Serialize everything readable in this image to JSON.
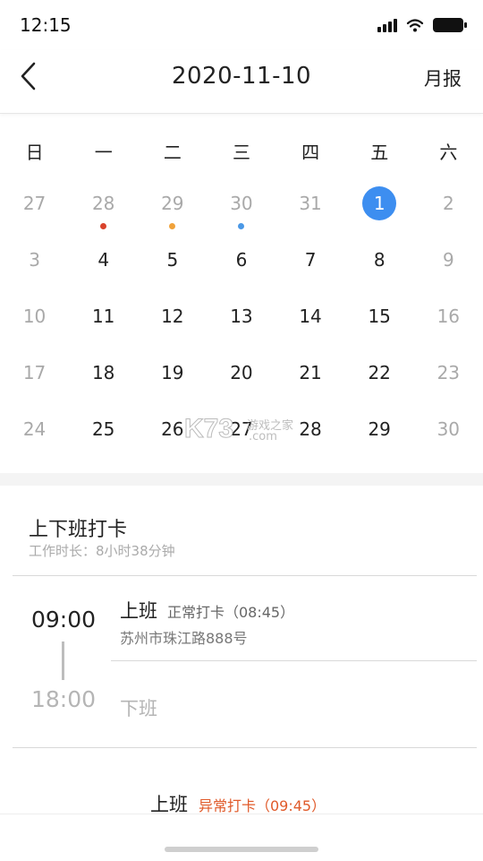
{
  "status_bar": {
    "time": "12:15"
  },
  "nav": {
    "title": "2020-11-10",
    "action": "月报"
  },
  "calendar": {
    "weekdays": [
      "日",
      "一",
      "二",
      "三",
      "四",
      "五",
      "六"
    ],
    "weeks": [
      [
        {
          "day": "27",
          "muted": true
        },
        {
          "day": "28",
          "muted": true,
          "dot": "#d9432c"
        },
        {
          "day": "29",
          "muted": true,
          "dot": "#f0a23a"
        },
        {
          "day": "30",
          "muted": true,
          "dot": "#4b98e6"
        },
        {
          "day": "31",
          "muted": true
        },
        {
          "day": "1",
          "selected": true
        },
        {
          "day": "2",
          "muted": true
        }
      ],
      [
        {
          "day": "3",
          "muted": true
        },
        {
          "day": "4"
        },
        {
          "day": "5"
        },
        {
          "day": "6"
        },
        {
          "day": "7"
        },
        {
          "day": "8"
        },
        {
          "day": "9",
          "muted": true
        }
      ],
      [
        {
          "day": "10",
          "muted": true
        },
        {
          "day": "11"
        },
        {
          "day": "12"
        },
        {
          "day": "13"
        },
        {
          "day": "14"
        },
        {
          "day": "15"
        },
        {
          "day": "16",
          "muted": true
        }
      ],
      [
        {
          "day": "17",
          "muted": true
        },
        {
          "day": "18"
        },
        {
          "day": "19"
        },
        {
          "day": "20"
        },
        {
          "day": "21"
        },
        {
          "day": "22"
        },
        {
          "day": "23",
          "muted": true
        }
      ],
      [
        {
          "day": "24",
          "muted": true
        },
        {
          "day": "25"
        },
        {
          "day": "26"
        },
        {
          "day": "27"
        },
        {
          "day": "28"
        },
        {
          "day": "29"
        },
        {
          "day": "30",
          "muted": true
        }
      ]
    ]
  },
  "watermark": {
    "brand": "K73",
    "cn": "游戏之家",
    "domain": ".com"
  },
  "attendance": {
    "title": "上下班打卡",
    "duration": "工作时长：8小时38分钟",
    "start_time": "09:00",
    "end_time": "18:00",
    "on_label": "上班",
    "on_status": "正常打卡（08:45）",
    "on_address": "苏州市珠江路888号",
    "off_label": "下班",
    "record_label": "上班",
    "record_status": "异常打卡（09:45）"
  },
  "colors": {
    "selected": "#3d8ef0",
    "abnormal": "#e05a2a"
  }
}
